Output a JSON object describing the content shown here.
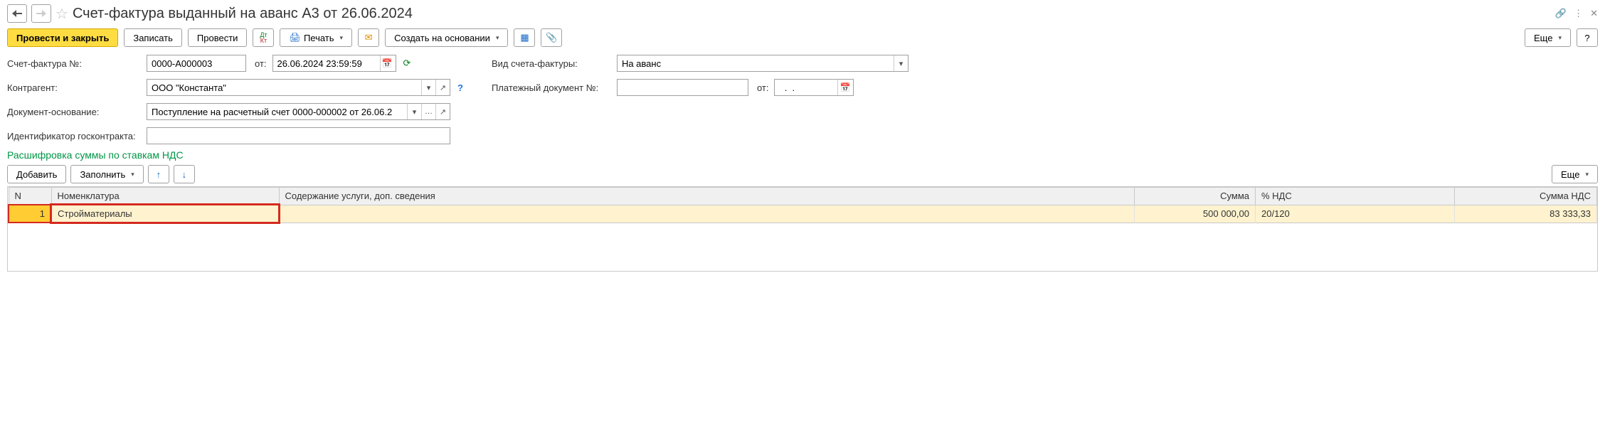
{
  "title": "Счет-фактура выданный на аванс А3 от 26.06.2024",
  "toolbar": {
    "post_close": "Провести и закрыть",
    "write": "Записать",
    "post": "Провести",
    "print": "Печать",
    "create_based": "Создать на основании",
    "more": "Еще"
  },
  "labels": {
    "invoice_no": "Счет-фактура №:",
    "from": "от:",
    "invoice_type": "Вид счета-фактуры:",
    "counterparty": "Контрагент:",
    "payment_doc": "Платежный документ №:",
    "payment_from": "от:",
    "basis_doc": "Документ-основание:",
    "gov_contract": "Идентификатор госконтракта:"
  },
  "fields": {
    "number": "0000-А000003",
    "date": "26.06.2024 23:59:59",
    "type": "На аванс",
    "counterparty": "ООО \"Константа\"",
    "basis": "Поступление на расчетный счет 0000-000002 от 26.06.2",
    "gov_contract": "",
    "payment_no": "",
    "payment_date": "  .  .    "
  },
  "section_title": "Расшифровка суммы по ставкам НДС",
  "subtoolbar": {
    "add": "Добавить",
    "fill": "Заполнить",
    "more": "Еще"
  },
  "table": {
    "headers": {
      "n": "N",
      "nomenclature": "Номенклатура",
      "content": "Содержание услуги, доп. сведения",
      "sum": "Сумма",
      "vat": "% НДС",
      "vat_sum": "Сумма НДС"
    },
    "rows": [
      {
        "n": "1",
        "nomenclature": "Стройматериалы",
        "content": "",
        "sum": "500 000,00",
        "vat": "20/120",
        "vat_sum": "83 333,33"
      }
    ]
  }
}
